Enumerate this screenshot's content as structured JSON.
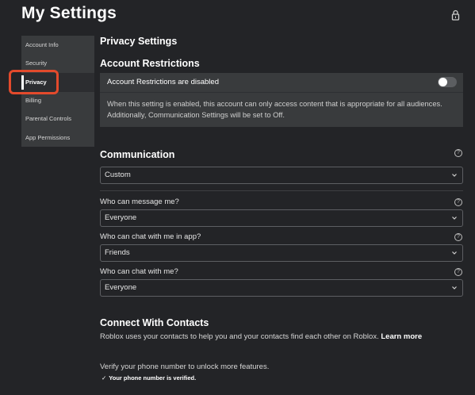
{
  "header": {
    "title": "My Settings",
    "lock_icon": "lock-icon"
  },
  "sidebar": {
    "items": [
      {
        "label": "Account Info",
        "active": false
      },
      {
        "label": "Security",
        "active": false
      },
      {
        "label": "Privacy",
        "active": true
      },
      {
        "label": "Billing",
        "active": false
      },
      {
        "label": "Parental Controls",
        "active": false
      },
      {
        "label": "App Permissions",
        "active": false
      }
    ],
    "highlight_color": "#e34a2c"
  },
  "privacy": {
    "title": "Privacy Settings",
    "restrictions": {
      "title": "Account Restrictions",
      "toggle_label": "Account Restrictions are disabled",
      "enabled": false,
      "description": "When this setting is enabled, this account can only access content that is appropriate for all audiences. Additionally, Communication Settings will be set to Off."
    },
    "communication": {
      "title": "Communication",
      "preset_value": "Custom",
      "fields": [
        {
          "label": "Who can message me?",
          "value": "Everyone"
        },
        {
          "label": "Who can chat with me in app?",
          "value": "Friends"
        },
        {
          "label": "Who can chat with me?",
          "value": "Everyone"
        }
      ]
    },
    "contacts": {
      "title": "Connect With Contacts",
      "description": "Roblox uses your contacts to help you and your contacts find each other on Roblox.",
      "learn_more": "Learn more",
      "verify_text": "Verify your phone number to unlock more features.",
      "verified_text": "Your phone number is verified.",
      "check_glyph": "✓"
    }
  },
  "colors": {
    "background": "#232427",
    "panel": "#393b3d",
    "text": "#ffffff"
  }
}
